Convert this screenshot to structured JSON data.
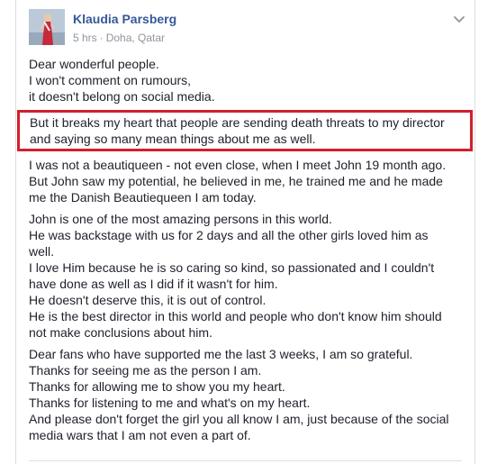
{
  "post": {
    "author": "Klaudia Parsberg",
    "time": "5 hrs",
    "separator": "·",
    "location": "Doha, Qatar",
    "icons": {
      "avatar": "profile-photo",
      "menu": "chevron-down-icon"
    },
    "accent_color": "#d21f2c",
    "link_color": "#365899",
    "paragraphs": [
      {
        "lines": [
          "Dear wonderful people.",
          "I won't comment on rumours,",
          "it doesn't belong on social media."
        ]
      },
      {
        "highlighted": true,
        "lines": [
          "But it breaks my heart that people are sending death threats to my director",
          "and saying so many mean things about me as well."
        ]
      },
      {
        "lines": [
          "I was not a beautiqueen - not even close, when I meet John 19 month ago.",
          "But John saw my potential, he believed in me, he trained me and he made",
          "me the Danish Beautiequeen I am today."
        ]
      },
      {
        "lines": [
          "John is one of the most amazing persons in this world.",
          "He was backstage with us for 2 days and all the other girls loved him as",
          "well.",
          "I love Him because he is so caring so kind, so passionated and I couldn't",
          "have done as well as I did if it wasn't for him.",
          "He doesn't deserve this, it is out of control.",
          "He is the best director in this world and people who don't know him should",
          "not make conclusions about him."
        ]
      },
      {
        "lines": [
          "Dear fans who have supported me the last 3 weeks, I am so grateful.",
          "Thanks for seeing me as the person I am.",
          "Thanks for allowing me to show you my heart.",
          "Thanks for listening to me and what's on my heart.",
          "And please don't forget the girl you all know I am, just because of the social",
          "media wars that I am not even a part of."
        ]
      }
    ]
  }
}
